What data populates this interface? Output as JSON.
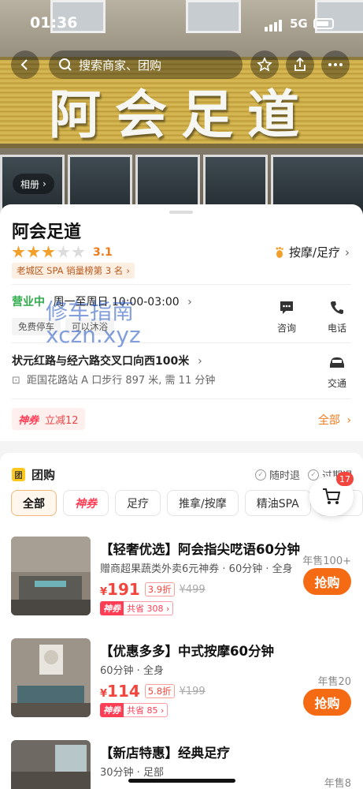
{
  "status": {
    "time": "01:36",
    "network": "5G"
  },
  "header": {
    "search_placeholder": "搜索商家、团购",
    "album_label": "相册"
  },
  "hero": {
    "sign_text": "阿会足道"
  },
  "shop": {
    "name": "阿会足道",
    "rating": "3.1",
    "rating_value": 3.1,
    "category": "按摩/足疗",
    "rank_tag": "老城区 SPA 销量榜第 3 名",
    "open_label": "营业中",
    "hours": "周一至周日 10:00-03:00",
    "feature_tags": [
      "免费停车",
      "可以沐浴"
    ],
    "address": "状元红路与经六路交叉口向西100米",
    "walk": "距国花路站 A 口步行 897 米, 需 11 分钟",
    "actions": {
      "consult": "咨询",
      "phone": "电话",
      "traffic": "交通"
    },
    "promo_badge": "神券",
    "promo_text": "立减12",
    "all_link": "全部"
  },
  "watermark": {
    "line1": "修车指南",
    "line2": "xczn.xyz"
  },
  "deals": {
    "title": "团购",
    "icon_text": "团",
    "policy_1": "随时退",
    "policy_2": "过期退",
    "filters": [
      "全部",
      "神券",
      "足疗",
      "推拿/按摩",
      "精油SPA",
      "采耳"
    ],
    "cart_count": "17",
    "items": [
      {
        "title": "【轻奢优选】阿会指尖呓语60分钟",
        "sub": "赠商超果蔬类外卖6元神券 · 60分钟 · 全身",
        "price": "191",
        "discount": "3.9折",
        "original": "¥499",
        "coupon_badge": "神券",
        "coupon_text": "共省 308",
        "sold": "年售100+",
        "buy": "抢购"
      },
      {
        "title": "【优惠多多】中式按摩60分钟",
        "sub": "60分钟 · 全身",
        "price": "114",
        "discount": "5.8折",
        "original": "¥199",
        "coupon_badge": "神券",
        "coupon_text": "共省 85",
        "sold": "年售20",
        "buy": "抢购"
      },
      {
        "title": "【新店特惠】经典足疗",
        "sub": "30分钟 · 足部",
        "sold": "年售8"
      }
    ],
    "currency": "¥"
  }
}
